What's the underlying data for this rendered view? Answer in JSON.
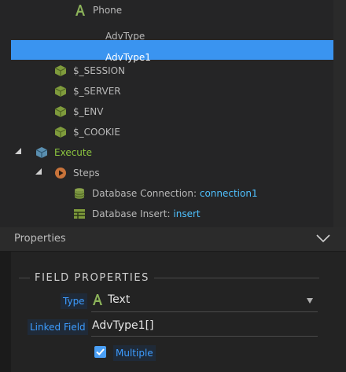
{
  "tree": {
    "phone_label": "Phone",
    "advtype_label": "AdvType",
    "advtype1_label": "AdvType1",
    "session_label": "$_SESSION",
    "server_label": "$_SERVER",
    "env_label": "$_ENV",
    "cookie_label": "$_COOKIE",
    "execute_label": "Execute",
    "steps_label": "Steps",
    "db_conn_label": "Database Connection:",
    "db_conn_value": "connection1",
    "db_insert_label": "Database Insert:",
    "db_insert_value": "insert"
  },
  "properties": {
    "title": "Properties",
    "section_title": "FIELD PROPERTIES",
    "type_label": "Type",
    "type_value": "Text",
    "linked_field_label": "Linked Field",
    "linked_field_value": "AdvType1[]",
    "multiple_label": "Multiple",
    "multiple_checked": true
  },
  "colors": {
    "selection": "#3a94f0",
    "accent_blue": "#4fc1ff",
    "execute_green": "#8cc63f"
  }
}
